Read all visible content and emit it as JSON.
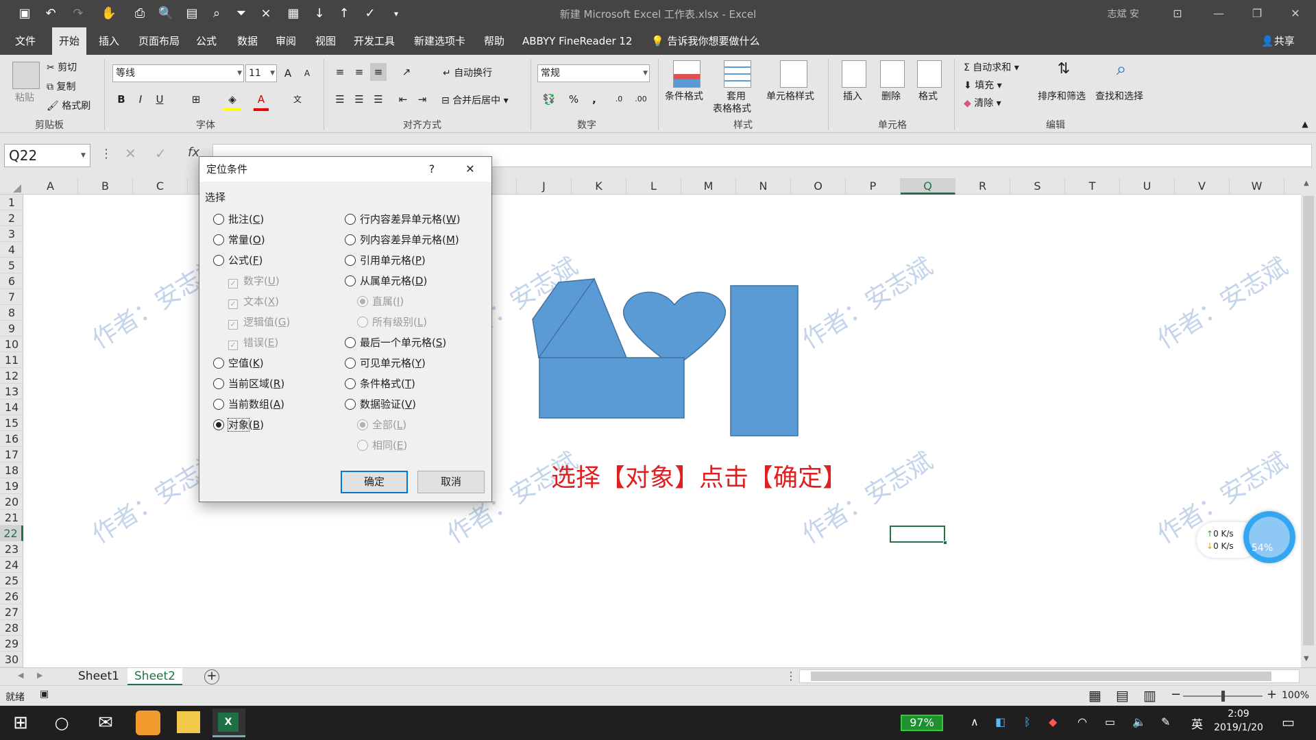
{
  "window": {
    "title": "新建 Microsoft Excel 工作表.xlsx  -  Excel",
    "user": "志斌 安"
  },
  "menu": {
    "tabs": [
      "文件",
      "开始",
      "插入",
      "页面布局",
      "公式",
      "数据",
      "审阅",
      "视图",
      "开发工具",
      "新建选项卡",
      "帮助",
      "ABBYY FineReader 12"
    ],
    "tellme": "告诉我你想要做什么",
    "share": "共享"
  },
  "ribbon": {
    "clipboard": {
      "paste": "粘贴",
      "cut": "剪切",
      "copy": "复制",
      "format_painter": "格式刷",
      "label": "剪贴板"
    },
    "font": {
      "name": "等线",
      "size": "11",
      "bold": "B",
      "italic": "I",
      "underline": "U",
      "label": "字体"
    },
    "alignment": {
      "wrap": "自动换行",
      "merge": "合并后居中",
      "label": "对齐方式"
    },
    "number": {
      "format": "常规",
      "percent": "%",
      "comma": ",",
      "label": "数字"
    },
    "styles": {
      "conditional": "条件格式",
      "table_line1": "套用",
      "table_line2": "表格格式",
      "cell_styles": "单元格样式",
      "label": "样式"
    },
    "cells": {
      "insert": "插入",
      "delete": "删除",
      "format": "格式",
      "label": "单元格"
    },
    "editing": {
      "autosum": "自动求和",
      "fill": "填充",
      "clear": "清除",
      "sort": "排序和筛选",
      "find": "查找和选择",
      "label": "编辑"
    }
  },
  "formula_bar": {
    "name_box": "Q22",
    "fx": "fx"
  },
  "columns": [
    "A",
    "B",
    "C",
    "D",
    "E",
    "F",
    "G",
    "H",
    "I",
    "J",
    "K",
    "L",
    "M",
    "N",
    "O",
    "P",
    "Q",
    "R",
    "S",
    "T",
    "U",
    "V",
    "W"
  ],
  "rows": [
    "1",
    "2",
    "3",
    "4",
    "5",
    "6",
    "7",
    "8",
    "9",
    "10",
    "11",
    "12",
    "13",
    "14",
    "15",
    "16",
    "17",
    "18",
    "19",
    "20",
    "21",
    "22",
    "23",
    "24",
    "25",
    "26",
    "27",
    "28",
    "29",
    "30"
  ],
  "sheet": {
    "watermark": "作者：安志斌",
    "annotation": "选择【对象】点击【确定】",
    "selected_cell": "Q22"
  },
  "dialog": {
    "title": "定位条件",
    "help": "?",
    "section": "选择",
    "left": [
      {
        "label": "批注",
        "key": "C",
        "type": "radio",
        "checked": false,
        "disabled": false
      },
      {
        "label": "常量",
        "key": "O",
        "type": "radio",
        "checked": false,
        "disabled": false
      },
      {
        "label": "公式",
        "key": "F",
        "type": "radio",
        "checked": false,
        "disabled": false
      },
      {
        "label": "数字",
        "key": "U",
        "type": "check",
        "checked": true,
        "disabled": true
      },
      {
        "label": "文本",
        "key": "X",
        "type": "check",
        "checked": true,
        "disabled": true
      },
      {
        "label": "逻辑值",
        "key": "G",
        "type": "check",
        "checked": true,
        "disabled": true
      },
      {
        "label": "错误",
        "key": "E",
        "type": "check",
        "checked": true,
        "disabled": true
      },
      {
        "label": "空值",
        "key": "K",
        "type": "radio",
        "checked": false,
        "disabled": false
      },
      {
        "label": "当前区域",
        "key": "R",
        "type": "radio",
        "checked": false,
        "disabled": false
      },
      {
        "label": "当前数组",
        "key": "A",
        "type": "radio",
        "checked": false,
        "disabled": false
      },
      {
        "label": "对象",
        "key": "B",
        "type": "radio",
        "checked": true,
        "disabled": false
      }
    ],
    "right": [
      {
        "label": "行内容差异单元格",
        "key": "W",
        "type": "radio",
        "checked": false,
        "disabled": false
      },
      {
        "label": "列内容差异单元格",
        "key": "M",
        "type": "radio",
        "checked": false,
        "disabled": false
      },
      {
        "label": "引用单元格",
        "key": "P",
        "type": "radio",
        "checked": false,
        "disabled": false
      },
      {
        "label": "从属单元格",
        "key": "D",
        "type": "radio",
        "checked": false,
        "disabled": false
      },
      {
        "label": "直属",
        "key": "I",
        "type": "radio",
        "checked": true,
        "disabled": true
      },
      {
        "label": "所有级别",
        "key": "L",
        "type": "radio",
        "checked": false,
        "disabled": true
      },
      {
        "label": "最后一个单元格",
        "key": "S",
        "type": "radio",
        "checked": false,
        "disabled": false
      },
      {
        "label": "可见单元格",
        "key": "Y",
        "type": "radio",
        "checked": false,
        "disabled": false
      },
      {
        "label": "条件格式",
        "key": "T",
        "type": "radio",
        "checked": false,
        "disabled": false
      },
      {
        "label": "数据验证",
        "key": "V",
        "type": "radio",
        "checked": false,
        "disabled": false
      },
      {
        "label": "全部",
        "key": "L",
        "type": "radio",
        "checked": true,
        "disabled": true
      },
      {
        "label": "相同",
        "key": "E",
        "type": "radio",
        "checked": false,
        "disabled": true
      }
    ],
    "ok": "确定",
    "cancel": "取消"
  },
  "sheet_tabs": [
    "Sheet1",
    "Sheet2"
  ],
  "status": {
    "ready": "就绪",
    "zoom": "100%"
  },
  "net_widget": {
    "up": "0  K/s",
    "down": "0  K/s",
    "percent": "54%"
  },
  "taskbar": {
    "battery": "97%",
    "ime": "英",
    "time": "2:09",
    "date": "2019/1/20"
  },
  "colors": {
    "accent": "#217346",
    "shape_fill": "#5b9bd5",
    "shape_stroke": "#41719c",
    "annotation": "#e02020",
    "title_bar": "#444444"
  }
}
